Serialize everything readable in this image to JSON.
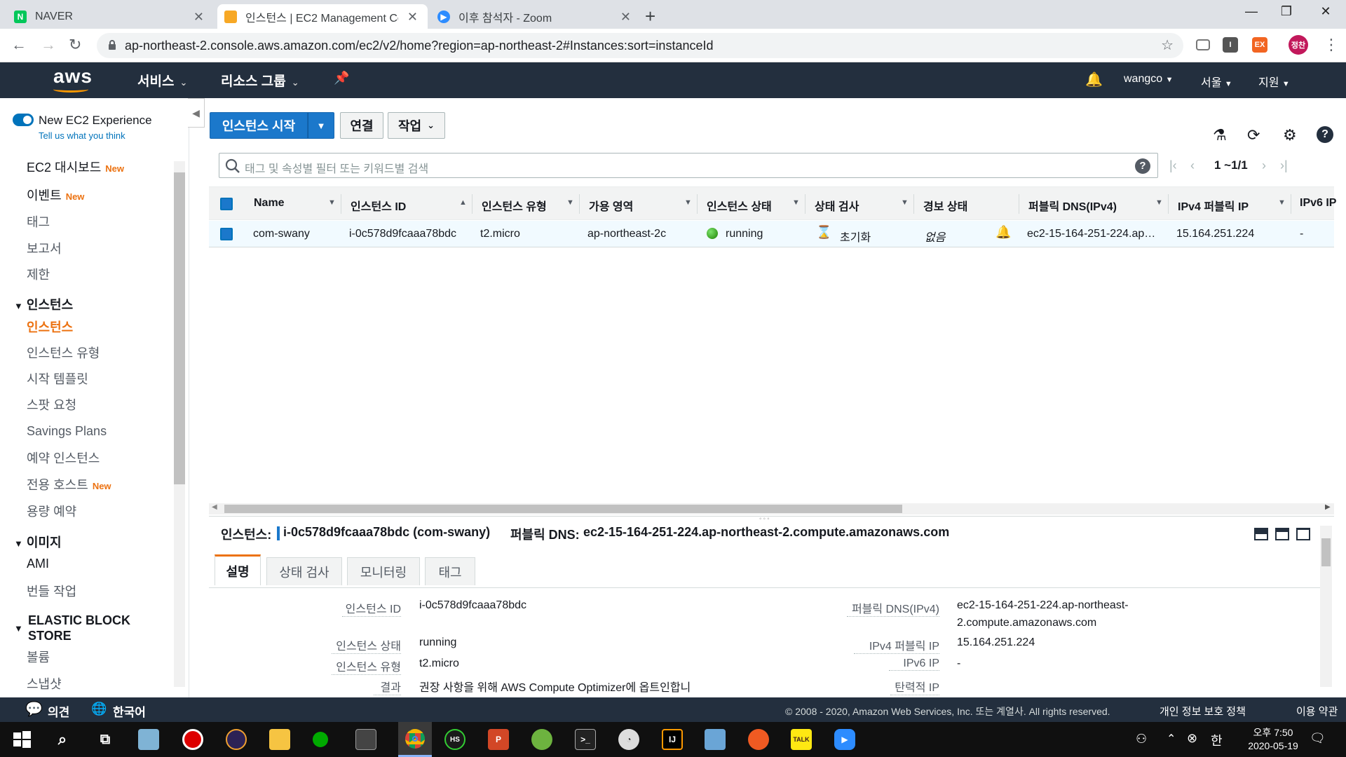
{
  "browser": {
    "tabs": [
      {
        "title": "NAVER",
        "favicon": "naver-icon"
      },
      {
        "title": "인스턴스 | EC2 Management Co",
        "favicon": "aws-icon"
      },
      {
        "title": "이후 참석자 - Zoom",
        "favicon": "zoom-icon"
      }
    ],
    "new_tab": "+",
    "close": "✕",
    "url": "ap-northeast-2.console.aws.amazon.com/ec2/v2/home?region=ap-northeast-2#Instances:sort=instanceId",
    "profile_badge": "정찬",
    "ext_label": "EX"
  },
  "aws_header": {
    "logo": "aws",
    "services": "서비스",
    "resource_groups": "리소스 그룹",
    "user": "wangco",
    "region": "서울",
    "support": "지원"
  },
  "sidebar": {
    "new_experience": "New EC2 Experience",
    "feedback": "Tell us what you think",
    "new_badge": "New",
    "items_top": [
      {
        "label": "EC2 대시보드",
        "new": true
      },
      {
        "label": "이벤트",
        "new": true
      },
      {
        "label": "태그",
        "new": false
      },
      {
        "label": "보고서",
        "new": false
      },
      {
        "label": "제한",
        "new": false
      }
    ],
    "section_instances": "인스턴스",
    "instances_items": [
      {
        "label": "인스턴스",
        "new": false
      },
      {
        "label": "인스턴스 유형",
        "new": false
      },
      {
        "label": "시작 템플릿",
        "new": false
      },
      {
        "label": "스팟 요청",
        "new": false
      },
      {
        "label": "Savings Plans",
        "new": false
      },
      {
        "label": "예약 인스턴스",
        "new": false
      },
      {
        "label": "전용 호스트",
        "new": true
      },
      {
        "label": "용량 예약",
        "new": false
      }
    ],
    "section_images": "이미지",
    "images_items": [
      "AMI",
      "번들 작업"
    ],
    "section_ebs_1": "ELASTIC BLOCK",
    "section_ebs_2": "STORE",
    "ebs_items": [
      "볼륨",
      "스냅샷"
    ]
  },
  "toolbar": {
    "launch": "인스턴스 시작",
    "connect": "연결",
    "actions": "작업"
  },
  "filter": {
    "placeholder": "태그 및 속성별 필터 또는 키워드별 검색",
    "help": "?"
  },
  "pagination": {
    "range": "1 ~1/1"
  },
  "table": {
    "columns": [
      "Name",
      "인스턴스 ID",
      "인스턴스 유형",
      "가용 영역",
      "인스턴스 상태",
      "상태 검사",
      "경보 상태",
      "퍼블릭 DNS(IPv4)",
      "IPv4 퍼블릭 IP",
      "IPv6 IP"
    ],
    "rows": [
      {
        "name": "com-swany",
        "instance_id": "i-0c578d9fcaaa78bdc",
        "type": "t2.micro",
        "zone": "ap-northeast-2c",
        "state": "running",
        "status_check": "초기화",
        "alarm": "없음",
        "public_dns": "ec2-15-164-251-224.ap…",
        "public_ip": "15.164.251.224",
        "ipv6": "-"
      }
    ],
    "state_color": "#1d8102"
  },
  "details": {
    "instance_label": "인스턴스:",
    "instance_value": "i-0c578d9fcaaa78bdc (com-swany)",
    "dns_label": "퍼블릭 DNS:",
    "dns_value": "ec2-15-164-251-224.ap-northeast-2.compute.amazonaws.com",
    "tabs": [
      "설명",
      "상태 검사",
      "모니터링",
      "태그"
    ],
    "left_fields": [
      {
        "label": "인스턴스 ID",
        "value": "i-0c578d9fcaaa78bdc"
      },
      {
        "label": "인스턴스 상태",
        "value": "running"
      },
      {
        "label": "인스턴스 유형",
        "value": "t2.micro"
      },
      {
        "label": "결과",
        "value": "권장 사항을 위해 AWS Compute Optimizer에 옵트인합니"
      }
    ],
    "right_fields": [
      {
        "label": "퍼블릭 DNS(IPv4)",
        "value": "ec2-15-164-251-224.ap-northeast-",
        "value2": "2.compute.amazonaws.com"
      },
      {
        "label": "IPv4 퍼블릭 IP",
        "value": "15.164.251.224"
      },
      {
        "label": "IPv6 IP",
        "value": "-"
      },
      {
        "label": "탄력적 IP",
        "value": ""
      }
    ]
  },
  "footer": {
    "feedback": "의견",
    "language": "한국어",
    "copyright": "© 2008 - 2020, Amazon Web Services, Inc. 또는 계열사. All rights reserved.",
    "privacy": "개인 정보 보호 정책",
    "terms": "이용 약관"
  },
  "taskbar": {
    "time": "오후 7:50",
    "date": "2020-05-19",
    "ime": "한"
  },
  "colors": {
    "aws_dark": "#232f3e",
    "aws_orange": "#ec7211",
    "aws_blue": "#1b78cb"
  }
}
